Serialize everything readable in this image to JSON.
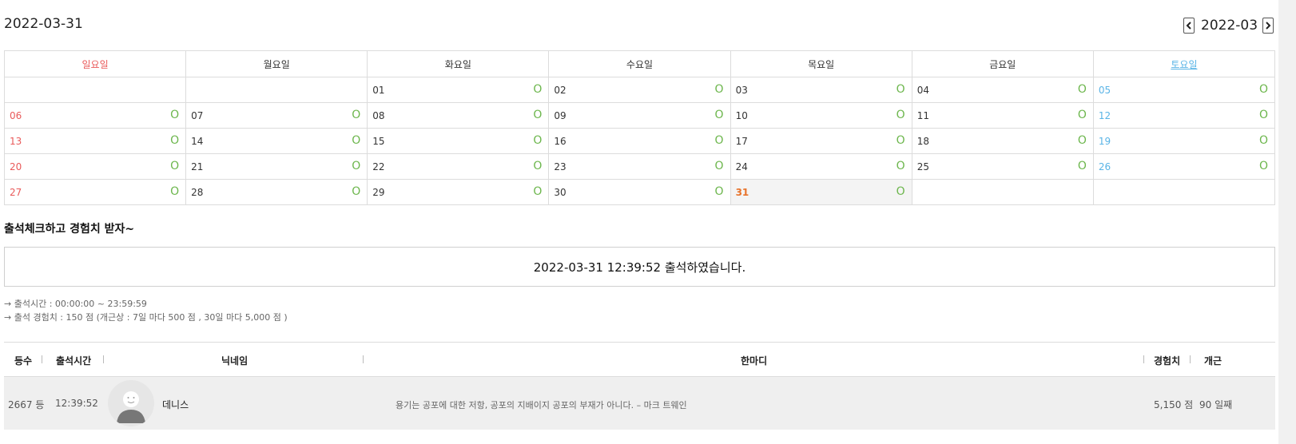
{
  "header": {
    "date": "2022-03-31",
    "month": "2022-03"
  },
  "calendar": {
    "weekdays": [
      "일요일",
      "월요일",
      "화요일",
      "수요일",
      "목요일",
      "금요일",
      "토요일"
    ],
    "mark": "O",
    "weeks": [
      [
        "",
        "",
        "01",
        "02",
        "03",
        "04",
        "05"
      ],
      [
        "06",
        "07",
        "08",
        "09",
        "10",
        "11",
        "12"
      ],
      [
        "13",
        "14",
        "15",
        "16",
        "17",
        "18",
        "19"
      ],
      [
        "20",
        "21",
        "22",
        "23",
        "24",
        "25",
        "26"
      ],
      [
        "27",
        "28",
        "29",
        "30",
        "31",
        "",
        ""
      ]
    ],
    "today": "31",
    "colors": {
      "sunday": "#e95a5a",
      "saturday": "#5ab4e6",
      "today": "#e8732b",
      "mark": "#6cb64c"
    }
  },
  "attendance": {
    "section_title": "출석체크하고 경험치 받자~",
    "message": "2022-03-31 12:39:52 출석하였습니다.",
    "info_time": "→ 출석시간 : 00:00:00 ~ 23:59:59",
    "info_exp": "→ 출석 경험치 : 150 점 (개근상 : 7일 마다 500 점 , 30일 마다 5,000 점 )"
  },
  "list": {
    "headers": {
      "rank": "등수",
      "time": "출석시간",
      "nickname": "닉네임",
      "comment": "한마디",
      "exp": "경험치",
      "streak": "개근"
    },
    "rows": [
      {
        "rank": "2667 등",
        "time": "12:39:52",
        "nickname": "데니스",
        "comment": "용기는 공포에 대한 저항, 공포의 지배이지 공포의 부재가 아니다. – 마크 트웨인",
        "exp": "5,150 점",
        "streak": "90 일째"
      }
    ]
  }
}
